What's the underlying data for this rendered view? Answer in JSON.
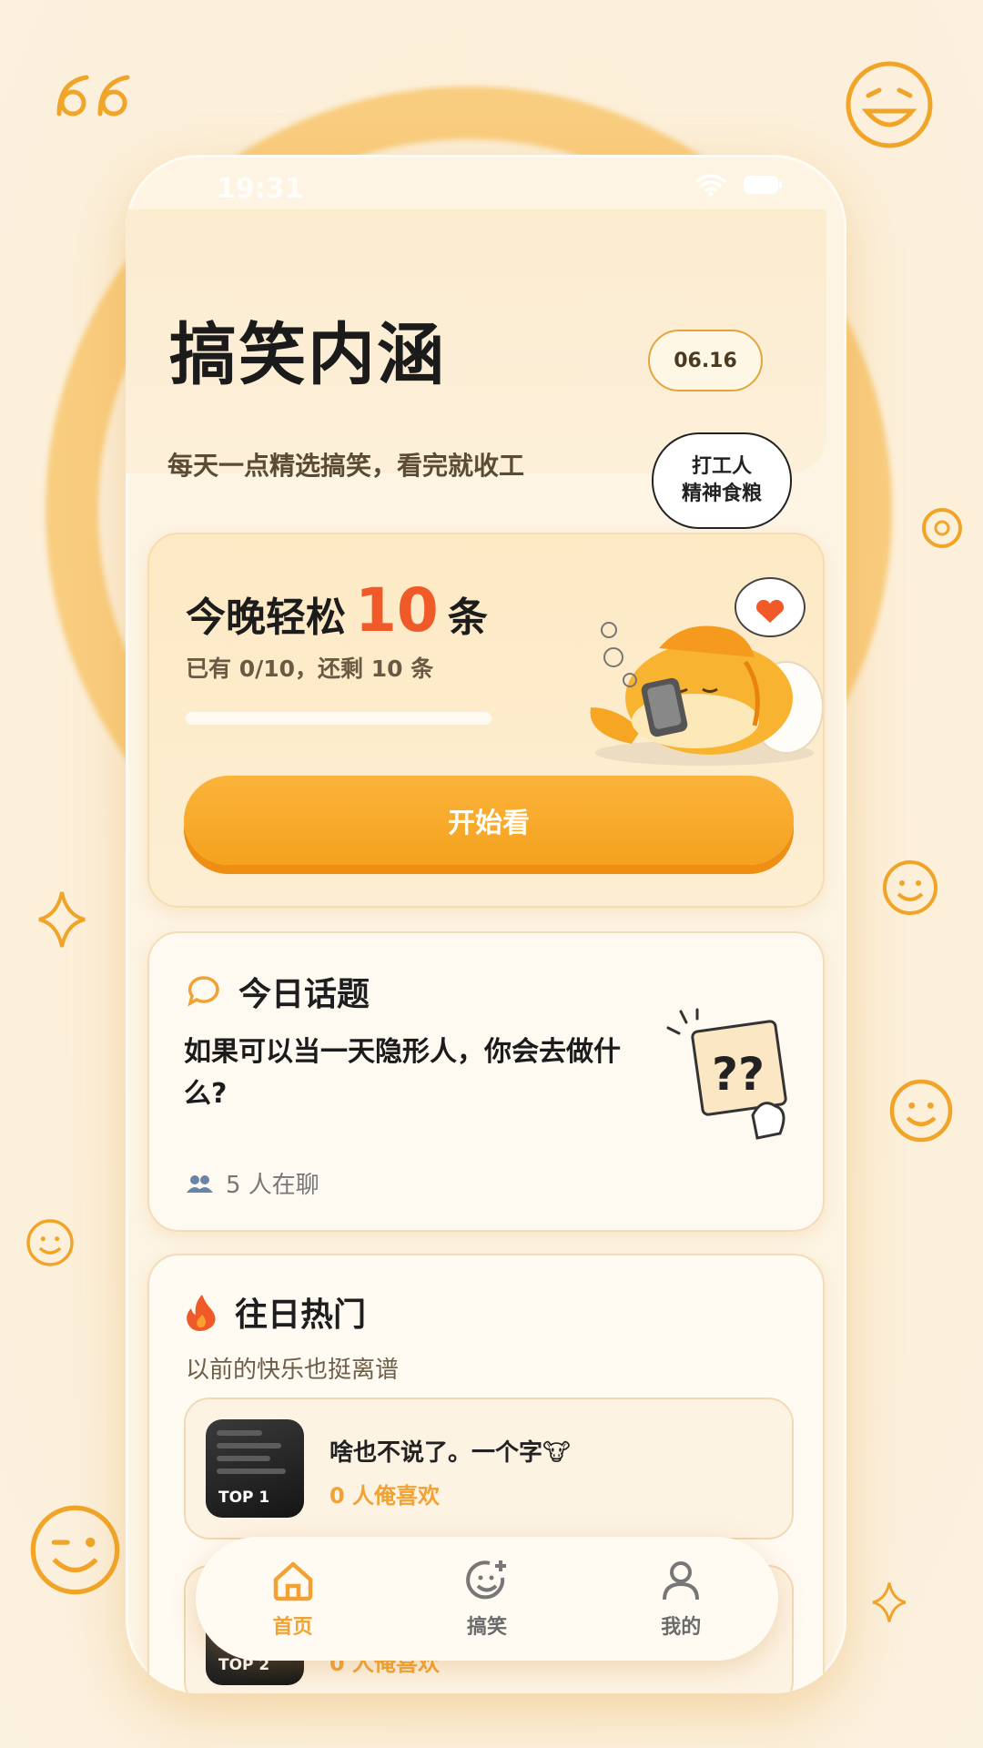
{
  "status": {
    "time": "19:31"
  },
  "header": {
    "title": "搞笑内涵",
    "date": "06.16",
    "subtitle": "每天一点精选搞笑，看完就收工",
    "badge_line1": "打工人",
    "badge_line2": "精神食粮"
  },
  "tonight": {
    "prefix": "今晚轻松",
    "count": "10",
    "suffix": "条",
    "progress_text": "已有 0/10，还剩 10 条",
    "progress_value": 0,
    "start_label": "开始看"
  },
  "topic": {
    "title": "今日话题",
    "question": "如果可以当一天隐形人，你会去做什么?",
    "people": "5 人在聊"
  },
  "hot": {
    "title": "往日热门",
    "subtitle": "以前的快乐也挺离谱",
    "items": [
      {
        "rank": "TOP 1",
        "text": "啥也不说了。一个字🐮",
        "likes": "0 人俺喜欢"
      },
      {
        "rank": "TOP 2",
        "text": "",
        "likes": "0 人俺喜欢"
      }
    ]
  },
  "tabs": [
    {
      "label": "首页",
      "icon": "home-icon",
      "active": true
    },
    {
      "label": "搞笑",
      "icon": "smile-plus-icon",
      "active": false
    },
    {
      "label": "我的",
      "icon": "user-icon",
      "active": false
    }
  ],
  "colors": {
    "accent": "#f5a623",
    "highlight": "#f05a28",
    "background": "#fcefd8"
  }
}
